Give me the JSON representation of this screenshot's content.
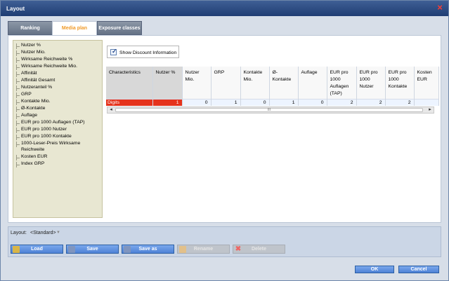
{
  "window": {
    "title": "Layout",
    "close_icon": "×"
  },
  "tabs": [
    {
      "label": "Ranking"
    },
    {
      "label": "Media plan"
    },
    {
      "label": "Exposure classes"
    }
  ],
  "left_list": [
    "Nutzer %",
    "Nutzer Mio.",
    "Wirksame Reichweite %",
    "Wirksame Reichweite Mio.",
    "Affinität",
    "Affinität Gesamt",
    "Nutzeranteil %",
    "GRP",
    "Kontakte Mio.",
    "Ø-Kontakte",
    "Auflage",
    "EUR pro 1000 Auflagen (TAP)",
    "EUR pro 1000 Nutzer",
    "EUR pro 1000 Kontakte",
    "1000-Leser-Preis Wirksame Reichweite",
    "Kosten EUR",
    "Index GRP"
  ],
  "checkbox": {
    "label": "Show Discount Information",
    "checked": true
  },
  "grid": {
    "columns": [
      "Characteristics",
      "Nutzer %",
      "Nutzer Mio.",
      "GRP",
      "Kontakte Mio.",
      "Ø-Kontakte",
      "Auflage",
      "EUR pro 1000 Auflagen (TAP)",
      "EUR pro 1000 Nutzer",
      "EUR pro 1000 Kontakte",
      "Kosten EUR"
    ],
    "row": {
      "label": "Digits",
      "values": [
        "1",
        "0",
        "1",
        "0",
        "1",
        "0",
        "2",
        "2",
        "2",
        ""
      ]
    },
    "scroll_thumb": "III"
  },
  "bottom": {
    "layout_label": "Layout:",
    "layout_value": "<Standard>",
    "buttons": [
      {
        "label": "Load",
        "icon": "folder-icon",
        "enabled": true
      },
      {
        "label": "Save",
        "icon": "save-icon",
        "enabled": true
      },
      {
        "label": "Save as",
        "icon": "save-as-icon",
        "enabled": true
      },
      {
        "label": "Rename",
        "icon": "rename-icon",
        "enabled": false
      },
      {
        "label": "Delete",
        "icon": "delete-icon",
        "enabled": false
      }
    ]
  },
  "footer": {
    "ok": "OK",
    "cancel": "Cancel"
  },
  "colors": {
    "title_bar": "#2f4f86",
    "tab_active_text": "#f09a28",
    "selected_cell": "#e5331c",
    "button": "#4e82d6"
  }
}
